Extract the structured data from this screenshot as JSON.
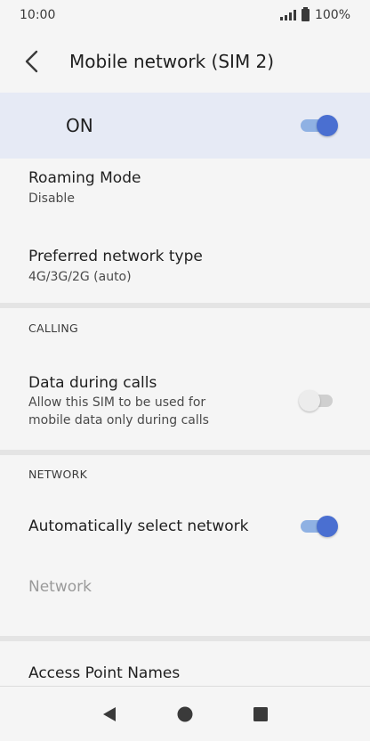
{
  "status_bar": {
    "time": "10:00",
    "battery": "100%"
  },
  "header": {
    "title": "Mobile network (SIM 2)",
    "back_icon": "chevron-left-icon"
  },
  "master_switch": {
    "label": "ON",
    "state": "on"
  },
  "rows": {
    "roaming": {
      "title": "Roaming Mode",
      "subtitle": "Disable"
    },
    "preferred": {
      "title": "Preferred network type",
      "subtitle": "4G/3G/2G (auto)"
    },
    "data_during_calls": {
      "title": "Data during calls",
      "subtitle_line1": "Allow this SIM to be used for",
      "subtitle_line2": "mobile data only during calls",
      "state": "off"
    },
    "auto_select": {
      "title": "Automatically select network",
      "state": "on"
    },
    "network": {
      "title": "Network",
      "disabled": true
    },
    "apn": {
      "title": "Access Point Names"
    }
  },
  "sections": {
    "calling": "CALLING",
    "network": "NETWORK"
  },
  "colors": {
    "accent": "#4a6fd1",
    "accent_track": "#8fb1e3",
    "highlight_bg": "#e6eaf5",
    "background": "#f5f5f5"
  },
  "nav_bar": {
    "back_icon": "triangle-back-icon",
    "home_icon": "circle-home-icon",
    "recents_icon": "square-recents-icon"
  }
}
